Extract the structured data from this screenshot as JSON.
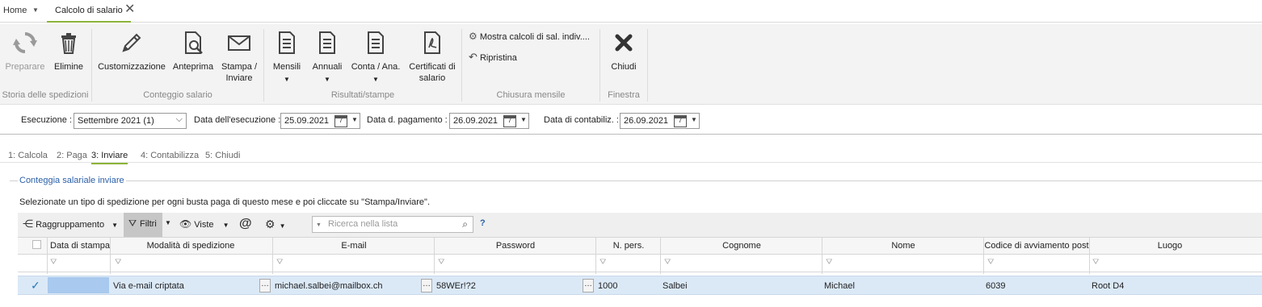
{
  "tabs": {
    "home": "Home",
    "active": "Calcolo di salario"
  },
  "ribbon": {
    "preparare": "Preparare",
    "elimine": "Elimine",
    "group_storia": "Storia delle spedizioni",
    "customizzazione": "Customizzazione",
    "anteprima": "Anteprima",
    "stampa_line1": "Stampa /",
    "stampa_line2": "Inviare",
    "group_conteggio": "Conteggio salario",
    "mensili": "Mensili",
    "annuali": "Annuali",
    "conta": "Conta / Ana.",
    "cert_line1": "Certificati di",
    "cert_line2": "salario",
    "group_risultati": "Risultati/stampe",
    "mostra": "Mostra calcoli di sal. indiv....",
    "ripristina": "Ripristina",
    "group_chiusura": "Chiusura mensile",
    "chiudi": "Chiudi",
    "group_finestra": "Finestra"
  },
  "exec": {
    "esecuzione_label": "Esecuzione :",
    "esecuzione_value": "Settembre 2021 (1)",
    "data_esec_label": "Data dell'esecuzione :",
    "data_esec_value": "25.09.2021",
    "data_pag_label": "Data d. pagamento :",
    "data_pag_value": "26.09.2021",
    "data_cont_label": "Data di contabiliz. :",
    "data_cont_value": "26.09.2021",
    "cal_day": "7"
  },
  "steps": [
    "1: Calcola",
    "2: Paga",
    "3: Inviare",
    "4: Contabilizza",
    "5: Chiudi"
  ],
  "section": {
    "title": "Conteggia salariale inviare",
    "description": "Selezionate un tipo di spedizione per ogni busta paga di questo mese e poi cliccate su \"Stampa/Inviare\"."
  },
  "grid_toolbar": {
    "raggruppamento": "Raggruppamento",
    "filtri": "Filtri",
    "viste": "Viste",
    "search_placeholder": "Ricerca nella lista",
    "help": "?"
  },
  "columns": [
    "Data di stampa",
    "Modalità di spedizione",
    "E-mail",
    "Password",
    "N. pers.",
    "Cognome",
    "Nome",
    "Codice di avviamento post",
    "Luogo"
  ],
  "rows": [
    {
      "data_stampa": "",
      "modalita": "Via e-mail criptata",
      "email": "michael.salbei@mailbox.ch",
      "password": "58WEr!?2",
      "n_pers": "1000",
      "cognome": "Salbei",
      "nome": "Michael",
      "cap": "6039",
      "luogo": "Root D4"
    }
  ],
  "colors": {
    "accent": "#8cb33a",
    "section_title": "#2a5fa8",
    "row_selected": "#dbe9f7"
  }
}
